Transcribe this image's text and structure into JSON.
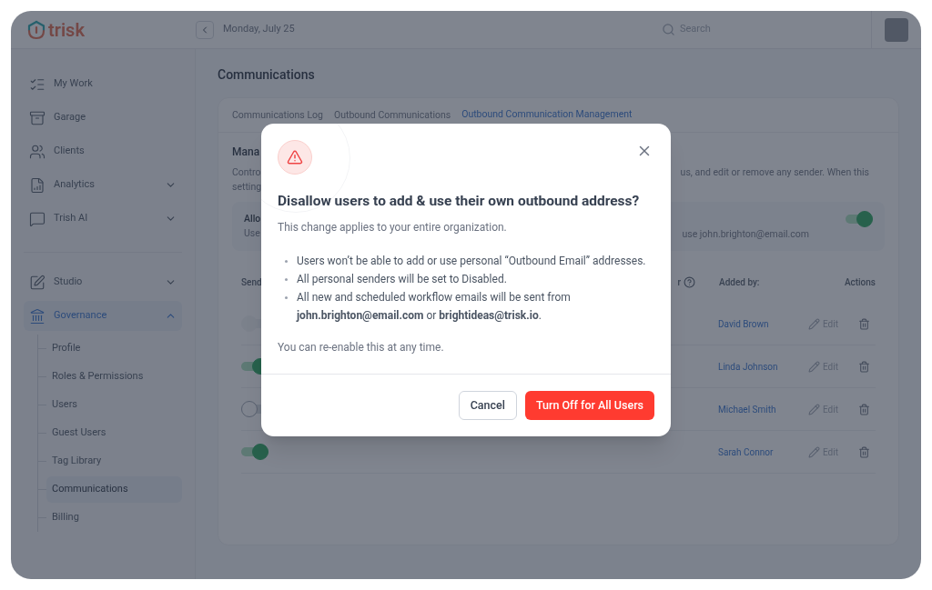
{
  "app": {
    "logo": "trisk",
    "date": "Monday, July 25",
    "search": {
      "placeholder": "Search"
    }
  },
  "sidebar": {
    "items": [
      {
        "label": "My Work",
        "selected": false
      },
      {
        "label": "Garage",
        "selected": false
      },
      {
        "label": "Clients",
        "selected": false
      },
      {
        "label": "Analytics",
        "expanded": false,
        "selected": false
      },
      {
        "label": "Trish AI",
        "expanded": false,
        "selected": false
      },
      {
        "kind": "divider"
      },
      {
        "label": "Studio",
        "expanded": false,
        "selected": false
      },
      {
        "label": "Governance",
        "selected": true,
        "expanded": true,
        "children": [
          {
            "label": "Profile",
            "selected": false
          },
          {
            "label": "Roles & Permissions",
            "selected": false
          },
          {
            "label": "Users",
            "selected": false
          },
          {
            "label": "Guest Users",
            "selected": false
          },
          {
            "label": "Tag Library",
            "selected": false
          },
          {
            "label": "Communications",
            "selected": true
          },
          {
            "label": "Billing",
            "selected": false
          }
        ]
      }
    ]
  },
  "page": {
    "title": "Communications",
    "tabs": [
      {
        "label": "Communications Log",
        "selected": false
      },
      {
        "label": "Outbound Communications",
        "selected": false
      },
      {
        "label": "Outbound Communication Management",
        "selected": true
      }
    ],
    "section_title": "Mana",
    "description_left": [
      "Contro",
      "setting"
    ],
    "description_right": "us, and edit or remove any sender. When this",
    "allow_card": {
      "title": "Allo",
      "subtitle": "Use",
      "note": "use john.brighton@email.com",
      "on": true
    },
    "table": {
      "columns": [
        "Send",
        "r",
        "Added by:",
        "Actions"
      ],
      "rows": [
        {
          "on": false,
          "disabled": true,
          "added_by": "David Brown",
          "edit": "Edit"
        },
        {
          "on": true,
          "disabled": false,
          "added_by": "Linda Johnson",
          "edit": "Edit"
        },
        {
          "on": false,
          "disabled": false,
          "added_by": "Michael Smith",
          "edit": "Edit"
        },
        {
          "on": true,
          "disabled": false,
          "added_by": "Sarah Connor",
          "edit": "Edit"
        }
      ]
    }
  },
  "dialog": {
    "title": "Disallow users to add & use their own outbound address?",
    "subtitle": "This change applies to your entire organization.",
    "bullets": [
      "Users won’t be able to add or use personal “Outbound Email” addresses.",
      "All personal senders will be set to Disabled.",
      "All new and scheduled workflow emails will be sent from **john.brighton@email.com** or **brightideas@trisk.io**."
    ],
    "footnote": "You can re-enable this at any time.",
    "buttons": [
      {
        "label": "Cancel",
        "kind": "secondary"
      },
      {
        "label": "Turn Off for All Users",
        "kind": "danger"
      }
    ]
  }
}
